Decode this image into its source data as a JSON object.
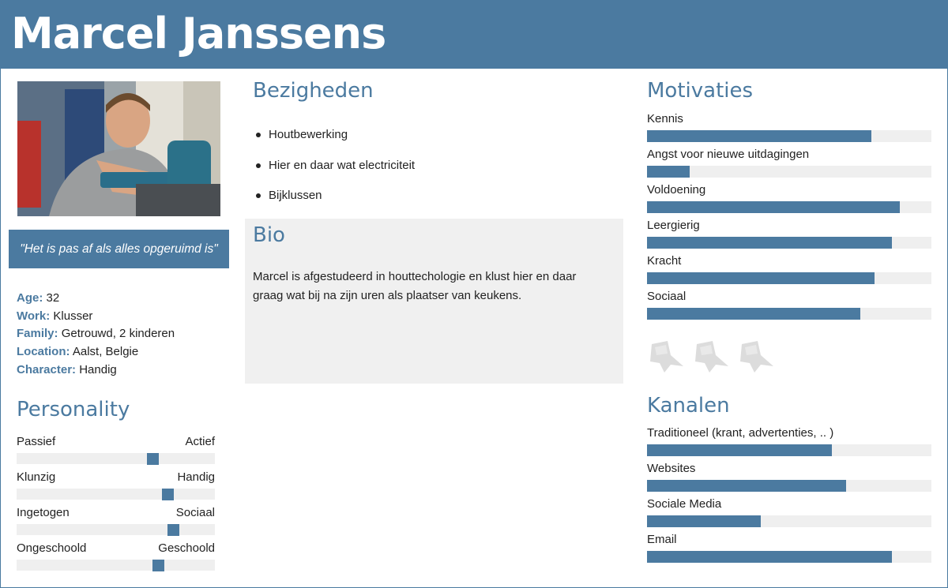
{
  "persona": {
    "name": "Marcel Janssens",
    "quote": "\"Het is pas af als alles opgeruimd is\""
  },
  "info": [
    {
      "label": "Age:",
      "value": "32"
    },
    {
      "label": "Work:",
      "value": "Klusser"
    },
    {
      "label": "Family:",
      "value": "Getrouwd, 2 kinderen"
    },
    {
      "label": "Location:",
      "value": "Aalst, Belgie"
    },
    {
      "label": "Character:",
      "value": "Handig"
    }
  ],
  "personality": {
    "title": "Personality",
    "traits": [
      {
        "left": "Passief",
        "right": "Actief",
        "level": 0.7
      },
      {
        "left": "Klunzig",
        "right": "Handig",
        "level": 0.78
      },
      {
        "left": "Ingetogen",
        "right": "Sociaal",
        "level": 0.81
      },
      {
        "left": "Ongeschoold",
        "right": "Geschoold",
        "level": 0.73
      }
    ]
  },
  "activities": {
    "title": "Bezigheden",
    "items": [
      "Houtbewerking",
      "Hier en daar wat electriciteit",
      "Bijklussen"
    ]
  },
  "bio": {
    "title": "Bio",
    "text": "Marcel is afgestudeerd in houttechologie en klust hier en daar graag wat bij na zijn uren als plaatser van keukens."
  },
  "motivations": {
    "title": "Motivaties",
    "items": [
      {
        "label": "Kennis",
        "value": 0.79
      },
      {
        "label": "Angst voor nieuwe uitdagingen",
        "value": 0.15
      },
      {
        "label": "Voldoening",
        "value": 0.89
      },
      {
        "label": "Leergierig",
        "value": 0.86
      },
      {
        "label": "Kracht",
        "value": 0.8
      },
      {
        "label": "Sociaal",
        "value": 0.75
      }
    ]
  },
  "logos": [
    {
      "icon": "fake-crow-logo"
    },
    {
      "icon": "fake-crow-logo"
    },
    {
      "icon": "fake-crow-logo"
    }
  ],
  "channels": {
    "title": "Kanalen",
    "items": [
      {
        "label": "Traditioneel (krant, advertenties, .. )",
        "value": 0.65
      },
      {
        "label": "Websites",
        "value": 0.7
      },
      {
        "label": "Sociale Media",
        "value": 0.4
      },
      {
        "label": "Email",
        "value": 0.86
      }
    ]
  },
  "colors": {
    "accent": "#4b7aa0",
    "track": "#efefef",
    "bio_bg": "#f0f0f0"
  }
}
